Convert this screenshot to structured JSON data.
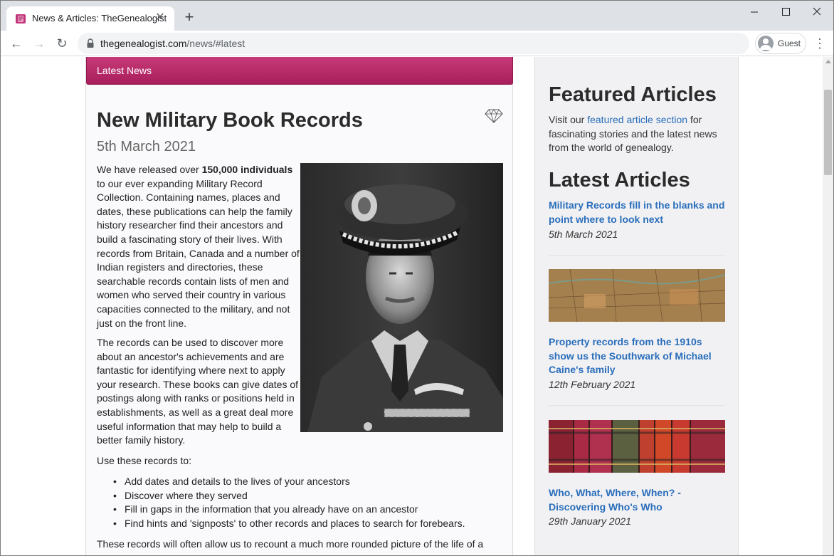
{
  "browser": {
    "tab_title": "News & Articles: TheGenealogist",
    "url_domain": "thegenealogist.com",
    "url_path": "/news/#latest",
    "profile_label": "Guest"
  },
  "main": {
    "header": "Latest News",
    "title": "New Military Book Records",
    "date": "5th March 2021",
    "p1_before": "We have released over ",
    "p1_bold": "150,000 individuals",
    "p1_after": " to our ever expanding Military Record Collection. Containing names, places and dates, these publications can help the family history researcher find their ancestors and build a fascinating story of their lives. With records from Britain, Canada and a number of Indian registers and directories, these searchable records contain lists of men and women who served their country in various capacities connected to the military, and not just on the front line.",
    "p2": "The records can be used to discover more about an ancestor's achievements and are fantastic for identifying where next to apply your research. These books can give dates of postings along with ranks or positions held in establishments, as well as a great deal more useful information that may help to build a better family history.",
    "p3": "Use these records to:",
    "bullets": [
      "Add dates and details to the lives of your ancestors",
      "Discover where they served",
      "Fill in gaps in the information that you already have on an ancestor",
      "Find hints and 'signposts' to other records and places to search for forebears."
    ],
    "p4": "These records will often allow us to recount a much more rounded picture of the life of a"
  },
  "sidebar": {
    "featured_heading": "Featured Articles",
    "featured_before": "Visit our ",
    "featured_link": "featured article section",
    "featured_after": " for fascinating stories and the latest news from the world of genealogy.",
    "latest_heading": "Latest Articles",
    "articles": [
      {
        "title": "Military Records fill in the blanks and point where to look next",
        "date": "5th March 2021"
      },
      {
        "title": "Property records from the 1910s show us the Southwark of Michael Caine's family",
        "date": "12th February 2021"
      },
      {
        "title": "Who, What, Where, When? - Discovering Who's Who",
        "date": "29th January 2021"
      }
    ]
  },
  "colors": {
    "accent": "#b5266a",
    "link": "#2a6ebb"
  }
}
